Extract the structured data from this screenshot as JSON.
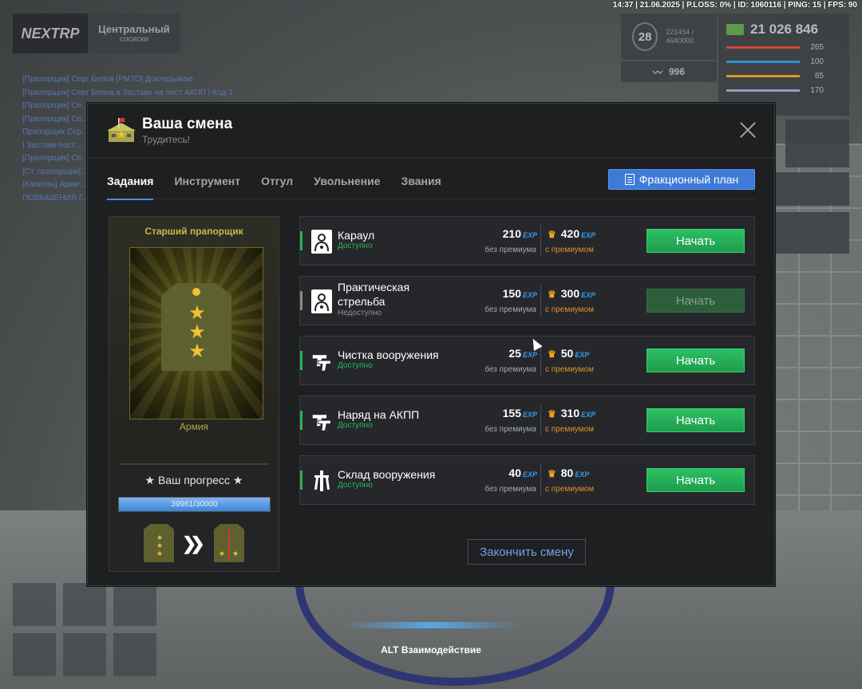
{
  "status_bar": "14:37 | 21.06.2025 | P.LOSS: 0% | ID: 1060116 | PING: 15 | FPS: 90",
  "server": {
    "logo": "NEXTRP",
    "name": "Центральный",
    "subtitle": "сосиски"
  },
  "hud": {
    "level": "28",
    "xp": "221454 / 4640000",
    "reputation": "996",
    "money": "21 026 846",
    "stats": [
      {
        "value": "265",
        "color": "#d2483b"
      },
      {
        "value": "100",
        "color": "#2f8fd8"
      },
      {
        "value": "85",
        "color": "#d59a2a"
      },
      {
        "value": "170",
        "color": "#8aa0c0"
      }
    ],
    "f2_count": "1",
    "f2_key": "F2",
    "f9_key": "F9"
  },
  "chat_lines": [
    "[Прапорщик] Серг Белов [РМТО] Докладываю",
    "[Прапорщик] Серг Белов в Заставе на пост АКПП | Код-1",
    "[Прапорщик] Се...",
    "[Прапорщик] Се...",
    "Прапорщик Сер...",
    "| Заставе пост...",
    "[Прапорщик] Се...",
    "[Ст. прапорщик]...",
    "[Капитан] Арми...",
    "ПОВЫШЕНИЯ Г..."
  ],
  "modal": {
    "title": "Ваша смена",
    "subtitle": "Трудитесь!",
    "tabs": [
      "Задания",
      "Инструмент",
      "Отгул",
      "Увольнение",
      "Звания"
    ],
    "active_tab": 0,
    "plan_button": "Фракционный план",
    "finish_button": "Закончить смену"
  },
  "rank": {
    "name": "Старший прапорщик",
    "branch": "Армия",
    "progress_label": "★ Ваш прогресс ★",
    "progress_text": "39961/30000",
    "progress_fraction": 1.0
  },
  "tasks": [
    {
      "name": "Караул",
      "status": "Доступно",
      "available": true,
      "exp": "210",
      "exp_premium": "420",
      "icon": "target-icon"
    },
    {
      "name": "Практическая стрельба",
      "status": "Недоступно",
      "available": false,
      "exp": "150",
      "exp_premium": "300",
      "icon": "target-icon"
    },
    {
      "name": "Чистка вооружения",
      "status": "Доступно",
      "available": true,
      "exp": "25",
      "exp_premium": "50",
      "icon": "pistols-icon"
    },
    {
      "name": "Наряд на АКПП",
      "status": "Доступно",
      "available": true,
      "exp": "155",
      "exp_premium": "310",
      "icon": "pistols-icon"
    },
    {
      "name": "Склад вооружения",
      "status": "Доступно",
      "available": true,
      "exp": "40",
      "exp_premium": "80",
      "icon": "weapon-stand-icon"
    }
  ],
  "labels": {
    "exp_unit": "EXP",
    "no_premium": "без премиума",
    "with_premium": "с премиумом",
    "start": "Начать"
  },
  "alt_hint": "ALT Взаимодействие"
}
